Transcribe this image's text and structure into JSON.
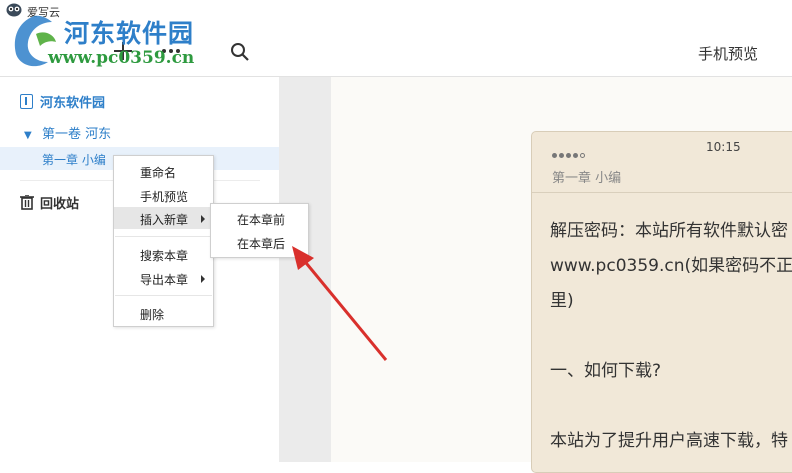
{
  "app": {
    "name": "爱写云"
  },
  "watermark": {
    "title": "河东软件园",
    "url": "www.pc0359.cn"
  },
  "toolbar": {
    "add_icon": "plus-icon",
    "more_icon": "more-dots-icon",
    "search_icon": "search-icon",
    "preview_label": "手机预览"
  },
  "sidebar": {
    "book": "河东软件园",
    "volume": "第一卷 河东",
    "chapter": "第一章 小编",
    "trash": "回收站"
  },
  "context_menu": {
    "items": [
      "重命名",
      "手机预览",
      "插入新章",
      "搜索本章",
      "导出本章",
      "删除"
    ],
    "active": "插入新章"
  },
  "submenu": {
    "items": [
      "在本章前",
      "在本章后"
    ]
  },
  "phone": {
    "time": "10:15",
    "chapter": "第一章 小编",
    "lines": [
      "解压密码：本站所有软件默认密",
      "www.pc0359.cn(如果密码不正",
      "里)",
      "",
      "一、如何下载?",
      "",
      "本站为了提升用户高速下载，特"
    ]
  },
  "colors": {
    "accent": "#2e7fc9",
    "watermark_green": "#2e9a3f",
    "arrow": "#d9302c",
    "phone_bg": "#f1e8d8"
  }
}
